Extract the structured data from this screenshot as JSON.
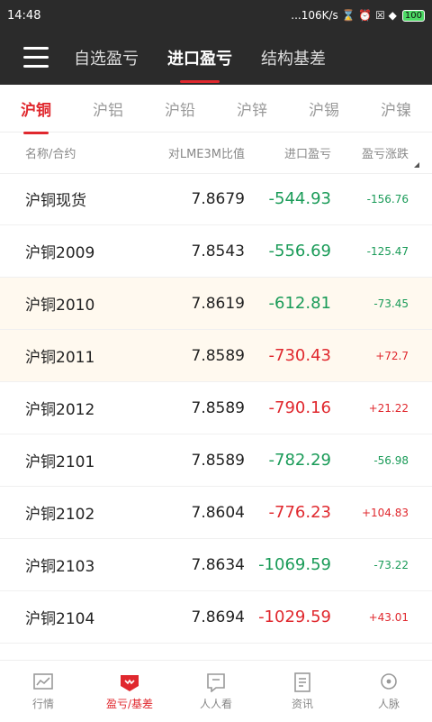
{
  "status": {
    "time": "14:48",
    "right": "...106K/s ⌛ ⏰ ☒ ◆",
    "battery": "100"
  },
  "nav": {
    "tabs": [
      "自选盈亏",
      "进口盈亏",
      "结构基差"
    ],
    "active": 1
  },
  "subtabs": {
    "items": [
      "沪铜",
      "沪铝",
      "沪铅",
      "沪锌",
      "沪锡",
      "沪镍"
    ],
    "active": 0
  },
  "table": {
    "headers": [
      "名称/合约",
      "对LME3M比值",
      "进口盈亏",
      "盈亏涨跌"
    ],
    "rows": [
      {
        "name": "沪铜现货",
        "ratio": "7.8679",
        "profit": "-544.93",
        "change": "-156.76",
        "profit_color": "green",
        "change_color": "green",
        "highlight": false
      },
      {
        "name": "沪铜2009",
        "ratio": "7.8543",
        "profit": "-556.69",
        "change": "-125.47",
        "profit_color": "green",
        "change_color": "green",
        "highlight": false
      },
      {
        "name": "沪铜2010",
        "ratio": "7.8619",
        "profit": "-612.81",
        "change": "-73.45",
        "profit_color": "green",
        "change_color": "green",
        "highlight": true
      },
      {
        "name": "沪铜2011",
        "ratio": "7.8589",
        "profit": "-730.43",
        "change": "+72.7",
        "profit_color": "red",
        "change_color": "red",
        "highlight": true
      },
      {
        "name": "沪铜2012",
        "ratio": "7.8589",
        "profit": "-790.16",
        "change": "+21.22",
        "profit_color": "red",
        "change_color": "red",
        "highlight": false
      },
      {
        "name": "沪铜2101",
        "ratio": "7.8589",
        "profit": "-782.29",
        "change": "-56.98",
        "profit_color": "green",
        "change_color": "green",
        "highlight": false
      },
      {
        "name": "沪铜2102",
        "ratio": "7.8604",
        "profit": "-776.23",
        "change": "+104.83",
        "profit_color": "red",
        "change_color": "red",
        "highlight": false
      },
      {
        "name": "沪铜2103",
        "ratio": "7.8634",
        "profit": "-1069.59",
        "change": "-73.22",
        "profit_color": "green",
        "change_color": "green",
        "highlight": false
      },
      {
        "name": "沪铜2104",
        "ratio": "7.8694",
        "profit": "-1029.59",
        "change": "+43.01",
        "profit_color": "red",
        "change_color": "red",
        "highlight": false
      }
    ]
  },
  "bottom": {
    "items": [
      {
        "label": "行情",
        "icon": "market-chart-icon"
      },
      {
        "label": "盈亏/基差",
        "icon": "profit-basis-icon"
      },
      {
        "label": "人人看",
        "icon": "chat-bubble-icon"
      },
      {
        "label": "资讯",
        "icon": "news-document-icon"
      },
      {
        "label": "人脉",
        "icon": "contacts-icon"
      }
    ],
    "active": 1
  },
  "colors": {
    "accent": "#e0282e",
    "up": "#e0282e",
    "down": "#1a9b58",
    "header_bg": "#2b2b2b"
  }
}
